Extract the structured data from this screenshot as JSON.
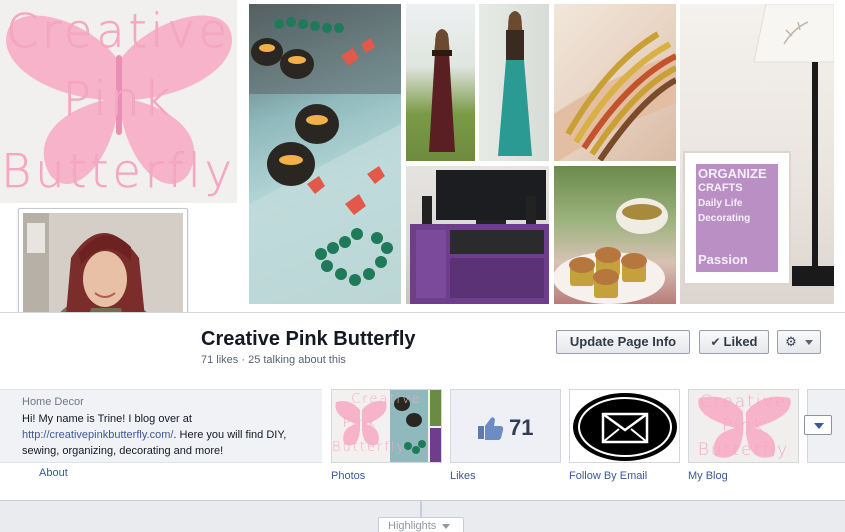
{
  "cover": {
    "logo_words": [
      "Creative",
      "Pink",
      "Butterfly"
    ],
    "colors": {
      "logo_pink": "#f4a9c4",
      "logo_background": "#f2f0ee"
    },
    "frame_poster_lines": [
      "ORGANIZE",
      "CRAFTS",
      "Daily Life",
      "Decorating",
      "Passion"
    ],
    "images": [
      "butterfly-logo-image",
      "candles-and-beads-photo",
      "maxi-dress-photo",
      "teal-skirt-photo",
      "gold-bracelets-photo",
      "purple-tv-stand-photo",
      "cupcakes-photo",
      "organize-frame-and-lamp-photo"
    ]
  },
  "profile": {
    "name": "Creative Pink Butterfly",
    "stats": "71 likes · 25 talking about this"
  },
  "actions": {
    "update_page_info": "Update Page Info",
    "liked": "Liked",
    "check_icon": "✔",
    "gear_icon": "⚙"
  },
  "about": {
    "category": "Home Decor",
    "bio_before_link": "Hi! My name is Trine! I blog over at ",
    "bio_link": "http://creativepinkbutterfly.com/",
    "bio_after_link": ". Here you will find DIY, sewing, organizing, decorating and more!",
    "about_link": "About"
  },
  "apps": [
    {
      "label": "Photos",
      "icon": "photos-collage-thumbnail"
    },
    {
      "label": "Likes",
      "icon": "thumbs-up-icon",
      "count": "71"
    },
    {
      "label": "Follow By Email",
      "icon": "envelope-icon"
    },
    {
      "label": "My Blog",
      "icon": "butterfly-logo-thumbnail"
    }
  ],
  "timeline": {
    "highlights": "Highlights"
  },
  "colors": {
    "link_blue": "#3b5998",
    "name_text": "#141823",
    "timeline_bg": "#e9ebee"
  }
}
